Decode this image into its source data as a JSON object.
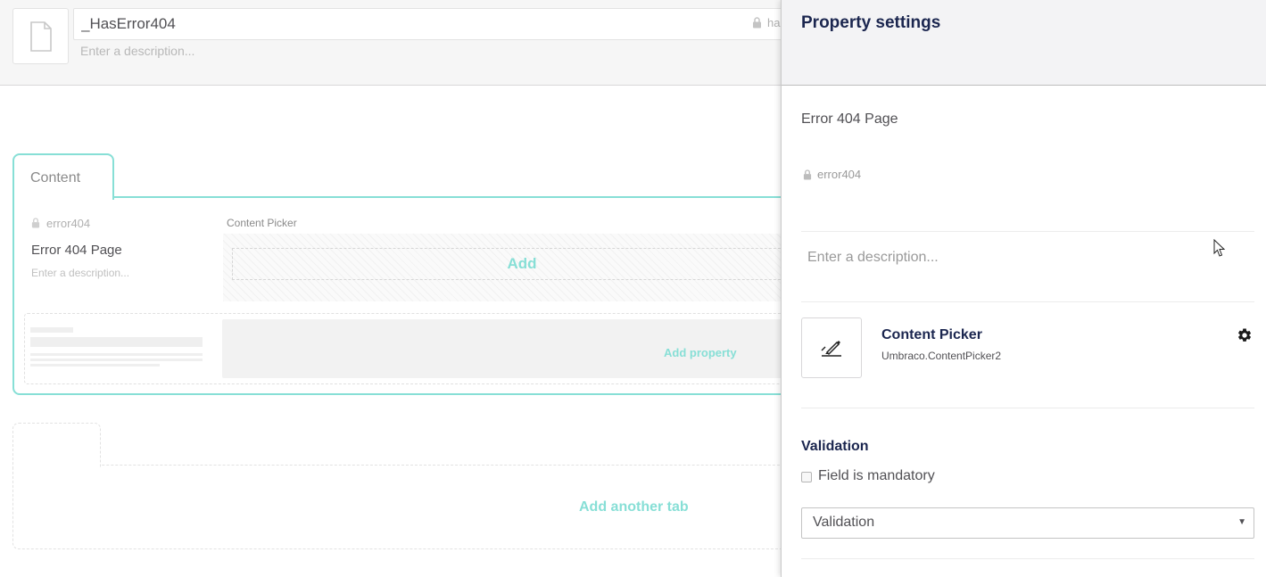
{
  "header": {
    "name_value": "_HasError404",
    "alias_text": "ha",
    "description_placeholder": "Enter a description..."
  },
  "content_tab": {
    "label": "Content",
    "property": {
      "alias": "error404",
      "name": "Error 404 Page",
      "description_placeholder": "Enter a description...",
      "editor_label": "Content Picker",
      "add_label": "Add"
    },
    "add_property_label": "Add property"
  },
  "add_tab_label": "Add another tab",
  "panel": {
    "title": "Property settings",
    "property_name": "Error 404 Page",
    "alias": "error404",
    "description_placeholder": "Enter a description...",
    "editor": {
      "name": "Content Picker",
      "alias": "Umbraco.ContentPicker2",
      "icon": "pencil-edit-icon",
      "settings_icon": "gear-icon"
    },
    "validation": {
      "title": "Validation",
      "mandatory_label": "Field is mandatory",
      "mandatory_checked": false,
      "select_value": "Validation"
    }
  },
  "colors": {
    "accent": "#87dfd6",
    "title": "#1b264f",
    "text": "#515054",
    "muted": "#9a9a9a"
  }
}
